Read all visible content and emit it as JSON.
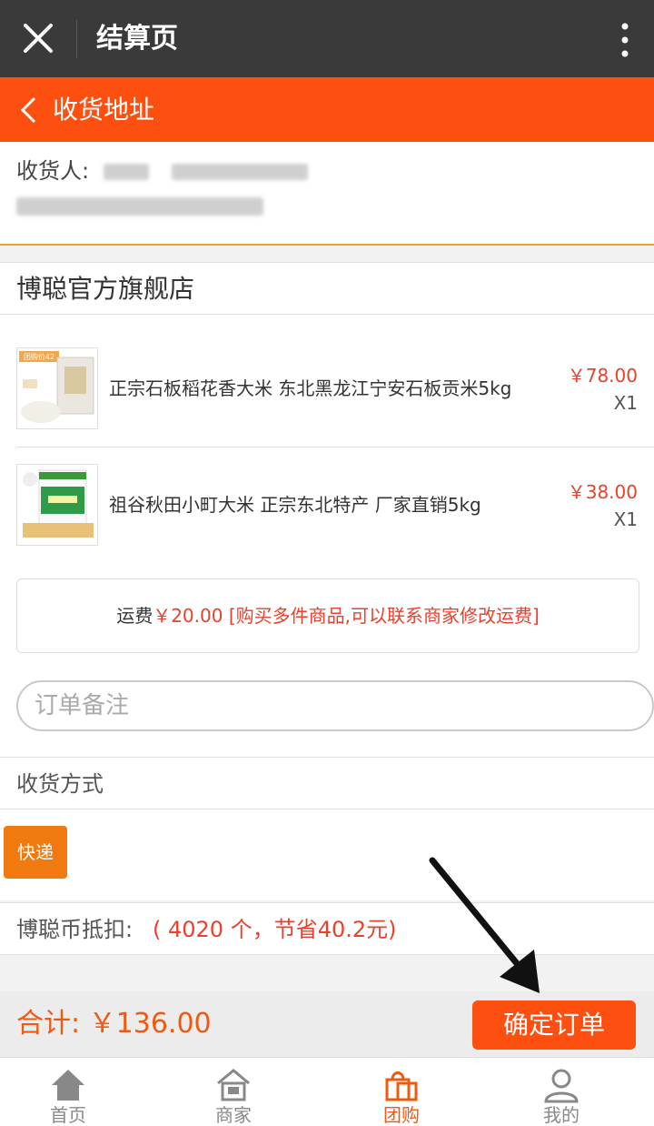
{
  "header": {
    "title": "结算页"
  },
  "subheader": {
    "title": "收货地址"
  },
  "address": {
    "recipient_label": "收货人:"
  },
  "shop": {
    "name": "博聪官方旗舰店"
  },
  "items": [
    {
      "name": "正宗石板稻花香大米 东北黑龙江宁安石板贡米5kg",
      "price": "￥78.00",
      "qty": "X1",
      "badge": "团购价42"
    },
    {
      "name": "祖谷秋田小町大米 正宗东北特产 厂家直销5kg",
      "price": "￥38.00",
      "qty": "X1"
    }
  ],
  "freight": {
    "label": "运费",
    "value": "￥20.00 [购买多件商品,可以联系商家修改运费]"
  },
  "note": {
    "placeholder": "订单备注"
  },
  "delivery": {
    "label": "收货方式",
    "option": "快递"
  },
  "coin": {
    "label": "博聪币抵扣:",
    "value": "( 4020 个，节省40.2元)"
  },
  "footer": {
    "total": "合计: ￥136.00",
    "confirm": "确定订单"
  },
  "tabs": [
    {
      "label": "首页",
      "icon": "home-icon"
    },
    {
      "label": "商家",
      "icon": "store-icon"
    },
    {
      "label": "团购",
      "icon": "shopping-bag-icon",
      "active": true
    },
    {
      "label": "我的",
      "icon": "user-icon"
    }
  ],
  "colors": {
    "accent": "#fd4f10",
    "price": "#e8412c",
    "titlebar": "#3a3a3a"
  }
}
